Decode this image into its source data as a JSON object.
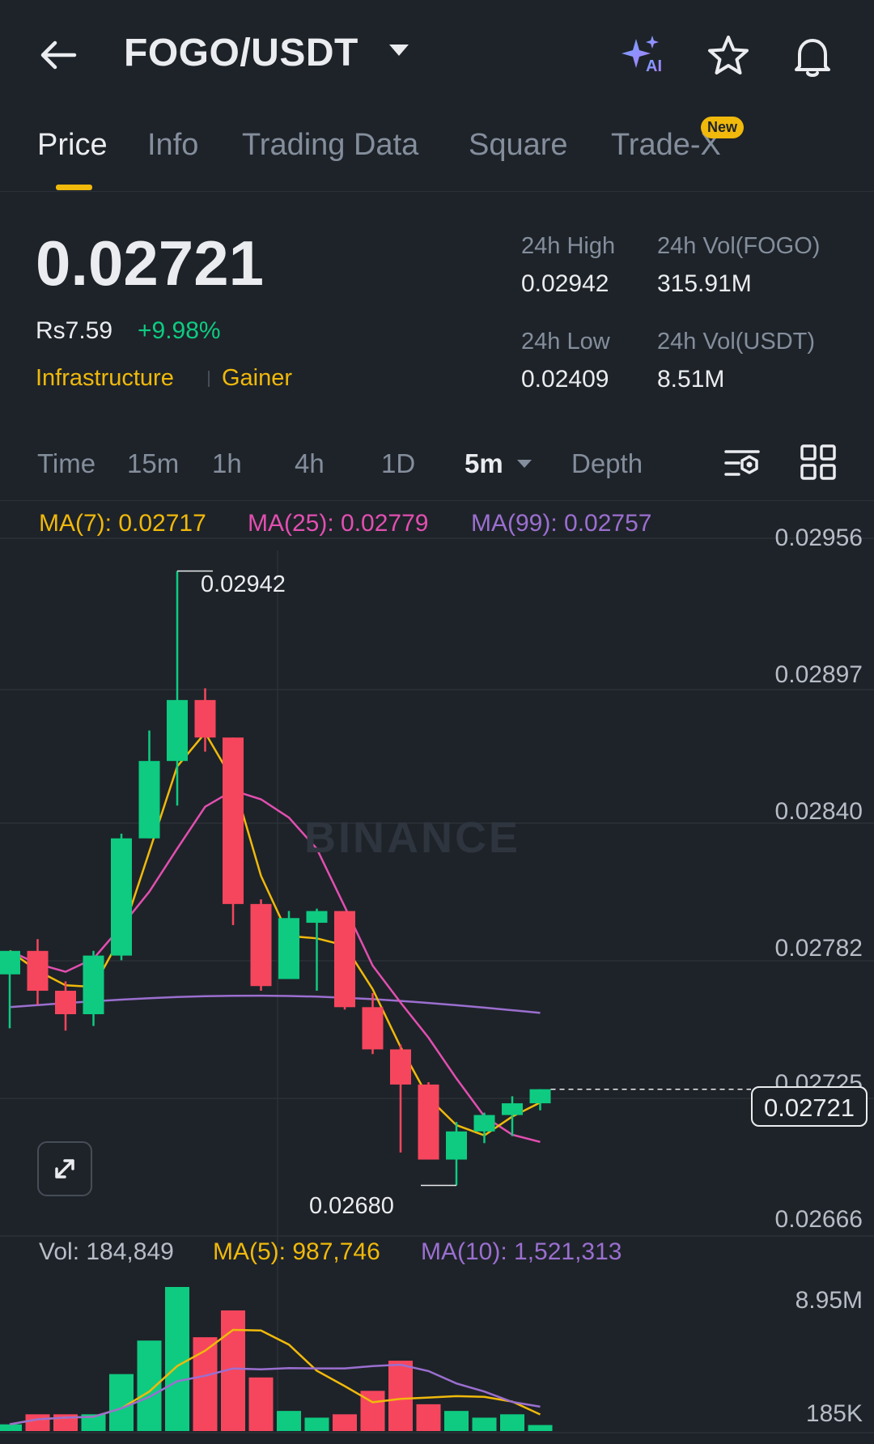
{
  "header": {
    "pair": "FOGO/USDT",
    "ai_badge": "AI",
    "icons": [
      "back-arrow-icon",
      "chevron-down-icon",
      "ai-sparkle-icon",
      "star-icon",
      "bell-icon"
    ]
  },
  "tabs": [
    {
      "label": "Price",
      "active": true
    },
    {
      "label": "Info"
    },
    {
      "label": "Trading Data"
    },
    {
      "label": "Square"
    },
    {
      "label": "Trade-X",
      "badge": "New"
    }
  ],
  "ticker": {
    "last_price": "0.02721",
    "fiat_price": "Rs7.59",
    "change_pct": "+9.98%",
    "tags": [
      "Infrastructure",
      "Gainer"
    ],
    "high_label": "24h High",
    "high": "0.02942",
    "low_label": "24h Low",
    "low": "0.02409",
    "vol_base_label": "24h Vol(FOGO)",
    "vol_base": "315.91M",
    "vol_quote_label": "24h Vol(USDT)",
    "vol_quote": "8.51M"
  },
  "intervals": {
    "items": [
      "Time",
      "15m",
      "1h",
      "4h",
      "1D",
      "5m",
      "Depth"
    ],
    "selected": "5m"
  },
  "ma_legend": {
    "ma7": "MA(7): 0.02717",
    "ma25": "MA(25): 0.02779",
    "ma99": "MA(99): 0.02757"
  },
  "vol_legend": {
    "vol": "Vol: 184,849",
    "ma5": "MA(5): 987,746",
    "ma10": "MA(10): 1,521,313"
  },
  "chart_annotations": {
    "high_marker": "0.02942",
    "low_marker": "0.02680",
    "last_price_tag": "0.02721",
    "watermark": "BINANCE"
  },
  "colors": {
    "up": "#0ecb81",
    "down": "#f6465d",
    "ma7": "#f0b90b",
    "ma25": "#e24fb0",
    "ma99": "#9b6fd0",
    "accent": "#f0b90b"
  },
  "chart_data": {
    "type": "candlestick",
    "interval": "5m",
    "price_axis": [
      "0.02956",
      "0.02897",
      "0.02840",
      "0.02782",
      "0.02725",
      "0.02666"
    ],
    "volume_axis": [
      "8.95M",
      "185K"
    ],
    "ylim": [
      0.02666,
      0.02956
    ],
    "candles": [
      {
        "o": 0.0277,
        "h": 0.0278,
        "l": 0.02747,
        "c": 0.0278
      },
      {
        "o": 0.0278,
        "h": 0.02785,
        "l": 0.02757,
        "c": 0.02763
      },
      {
        "o": 0.02763,
        "h": 0.02767,
        "l": 0.02746,
        "c": 0.02753
      },
      {
        "o": 0.02753,
        "h": 0.0278,
        "l": 0.02748,
        "c": 0.02778
      },
      {
        "o": 0.02778,
        "h": 0.0283,
        "l": 0.02776,
        "c": 0.02828
      },
      {
        "o": 0.02828,
        "h": 0.02874,
        "l": 0.02828,
        "c": 0.02861
      },
      {
        "o": 0.02861,
        "h": 0.02942,
        "l": 0.02842,
        "c": 0.02887
      },
      {
        "o": 0.02887,
        "h": 0.02892,
        "l": 0.02865,
        "c": 0.02871
      },
      {
        "o": 0.02871,
        "h": 0.02871,
        "l": 0.02791,
        "c": 0.028
      },
      {
        "o": 0.028,
        "h": 0.02802,
        "l": 0.02763,
        "c": 0.02765
      },
      {
        "o": 0.02768,
        "h": 0.02797,
        "l": 0.02768,
        "c": 0.02794
      },
      {
        "o": 0.02792,
        "h": 0.02798,
        "l": 0.02763,
        "c": 0.02797
      },
      {
        "o": 0.02797,
        "h": 0.02797,
        "l": 0.02755,
        "c": 0.02756
      },
      {
        "o": 0.02756,
        "h": 0.02762,
        "l": 0.02736,
        "c": 0.02738
      },
      {
        "o": 0.02738,
        "h": 0.0274,
        "l": 0.02694,
        "c": 0.02723
      },
      {
        "o": 0.02723,
        "h": 0.02724,
        "l": 0.02692,
        "c": 0.02691
      },
      {
        "o": 0.02691,
        "h": 0.02707,
        "l": 0.0268,
        "c": 0.02703
      },
      {
        "o": 0.02703,
        "h": 0.02711,
        "l": 0.02698,
        "c": 0.0271
      },
      {
        "o": 0.0271,
        "h": 0.02718,
        "l": 0.02701,
        "c": 0.02715
      },
      {
        "o": 0.02715,
        "h": 0.02721,
        "l": 0.02712,
        "c": 0.02721
      }
    ],
    "volumes": [
      0.2,
      0.5,
      0.5,
      0.5,
      1.7,
      2.7,
      4.3,
      2.8,
      3.6,
      1.6,
      0.6,
      0.4,
      0.5,
      1.2,
      2.1,
      0.8,
      0.6,
      0.4,
      0.5,
      0.18
    ]
  }
}
